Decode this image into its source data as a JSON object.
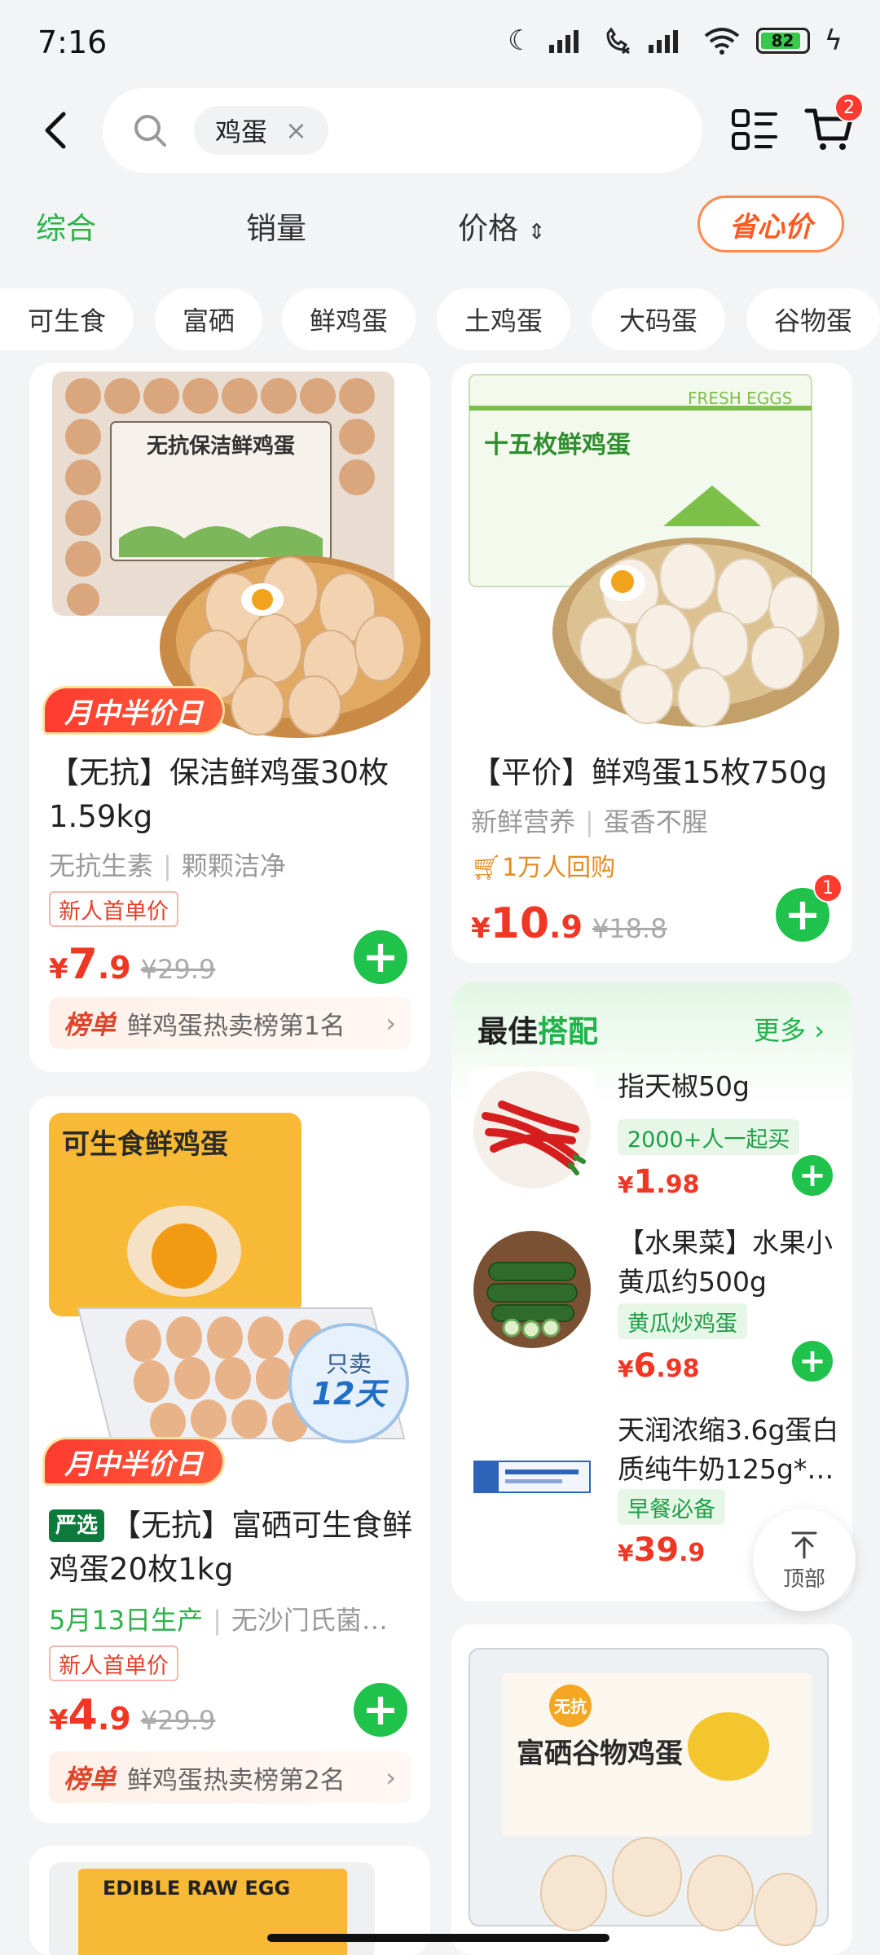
{
  "status_bar": {
    "time": "7:16",
    "battery": "82"
  },
  "search": {
    "query": "鸡蛋",
    "cart_count": "2"
  },
  "sort_tabs": {
    "comprehensive": "综合",
    "sales": "销量",
    "price": "价格",
    "value_price": "省心价"
  },
  "filters": [
    "可生食",
    "富硒",
    "鲜鸡蛋",
    "土鸡蛋",
    "大码蛋",
    "谷物蛋"
  ],
  "products": [
    {
      "promo": "月中半价日",
      "title": "【无抗】保洁鲜鸡蛋30枚1.59kg",
      "tags": [
        "无抗生素",
        "颗颗洁净"
      ],
      "newbie": "新人首单价",
      "price_symbol": "¥",
      "price_int": "7",
      "price_dec": ".9",
      "old_price": "¥29.9",
      "rank_tag": "榜单",
      "rank_text": "鲜鸡蛋热卖榜第1名",
      "package_label": "无抗保洁鲜鸡蛋"
    },
    {
      "title": "【平价】鲜鸡蛋15枚750g",
      "tags": [
        "新鲜营养",
        "蛋香不腥"
      ],
      "repurchase": "1万人回购",
      "price_symbol": "¥",
      "price_int": "10",
      "price_dec": ".9",
      "old_price": "¥18.8",
      "cart_count": "1",
      "package_label": "十五枚鲜鸡蛋",
      "package_sub": "FRESH EGGS"
    },
    {
      "promo": "月中半价日",
      "brand": "严选",
      "title": "【无抗】富硒可生食鲜鸡蛋20枚1kg",
      "date": "5月13日生产",
      "extra": "无沙门氏菌…",
      "newbie": "新人首单价",
      "price_symbol": "¥",
      "price_int": "4",
      "price_dec": ".9",
      "old_price": "¥29.9",
      "rank_tag": "榜单",
      "rank_text": "鲜鸡蛋热卖榜第2名",
      "package_label": "可生食鲜鸡蛋",
      "sticker_top": "只卖",
      "sticker_days": "12天"
    },
    {
      "package_label": "富硒谷物鸡蛋",
      "badge": "无抗"
    },
    {
      "package_label": "EDIBLE RAW EGG"
    }
  ],
  "combo": {
    "title_a": "最佳",
    "title_b": "搭配",
    "more": "更多",
    "items": [
      {
        "title": "指天椒50g",
        "tag": "2000+人一起买",
        "price_symbol": "¥",
        "price_int": "1",
        "price_dec": ".98"
      },
      {
        "title": "【水果菜】水果小黄瓜约500g",
        "tag": "黄瓜炒鸡蛋",
        "price_symbol": "¥",
        "price_int": "6",
        "price_dec": ".98"
      },
      {
        "title": "天润浓缩3.6g蛋白质纯牛奶125g*…",
        "tag": "早餐必备",
        "price_symbol": "¥",
        "price_int": "39",
        "price_dec": ".9"
      }
    ]
  },
  "to_top": "顶部"
}
